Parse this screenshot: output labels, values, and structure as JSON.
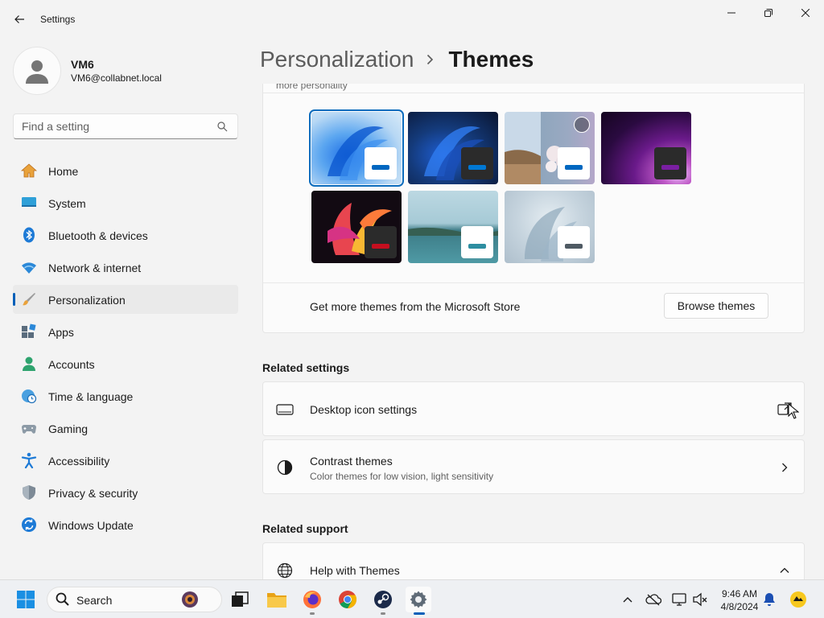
{
  "window": {
    "app_title": "Settings"
  },
  "profile": {
    "name": "VM6",
    "email": "VM6@collabnet.local"
  },
  "search": {
    "placeholder": "Find a setting"
  },
  "nav": {
    "items": [
      {
        "label": "Home",
        "icon": "home-icon",
        "selected": false
      },
      {
        "label": "System",
        "icon": "system-icon",
        "selected": false
      },
      {
        "label": "Bluetooth & devices",
        "icon": "bluetooth-icon",
        "selected": false
      },
      {
        "label": "Network & internet",
        "icon": "wifi-icon",
        "selected": false
      },
      {
        "label": "Personalization",
        "icon": "brush-icon",
        "selected": true
      },
      {
        "label": "Apps",
        "icon": "apps-icon",
        "selected": false
      },
      {
        "label": "Accounts",
        "icon": "accounts-icon",
        "selected": false
      },
      {
        "label": "Time & language",
        "icon": "clock-globe-icon",
        "selected": false
      },
      {
        "label": "Gaming",
        "icon": "gamepad-icon",
        "selected": false
      },
      {
        "label": "Accessibility",
        "icon": "accessibility-icon",
        "selected": false
      },
      {
        "label": "Privacy & security",
        "icon": "shield-icon",
        "selected": false
      },
      {
        "label": "Windows Update",
        "icon": "update-icon",
        "selected": false
      }
    ]
  },
  "header": {
    "parent": "Personalization",
    "current": "Themes"
  },
  "themes": {
    "cut_off_text": "more personality",
    "items": [
      {
        "name": "windows-light",
        "selected": true,
        "accent": "#0067c0",
        "badge": "#ffffff"
      },
      {
        "name": "windows-dark",
        "selected": false,
        "accent": "#0078d4",
        "badge": "#2b2b2b"
      },
      {
        "name": "windows-spotlight",
        "selected": false,
        "accent": "#0067c0",
        "badge": "#ffffff"
      },
      {
        "name": "glow",
        "selected": false,
        "accent": "#7a1fa2",
        "badge": "#2b2b2b"
      },
      {
        "name": "captured-motion",
        "selected": false,
        "accent": "#c50f1f",
        "badge": "#2b2b2b"
      },
      {
        "name": "sunrise",
        "selected": false,
        "accent": "#2d8ea1",
        "badge": "#ffffff"
      },
      {
        "name": "flow",
        "selected": false,
        "accent": "#4f5a63",
        "badge": "#ffffff"
      }
    ],
    "store_text": "Get more themes from the Microsoft Store",
    "browse_label": "Browse themes"
  },
  "related_settings": {
    "title": "Related settings",
    "desktop_icons": {
      "title": "Desktop icon settings",
      "icon": "monitor-icon",
      "end_icon": "open-external-icon"
    },
    "contrast": {
      "title": "Contrast themes",
      "subtitle": "Color themes for low vision, light sensitivity",
      "icon": "contrast-icon",
      "end_icon": "chevron-right-icon"
    }
  },
  "related_support": {
    "title": "Related support",
    "help": {
      "title": "Help with Themes",
      "icon": "globe-icon",
      "end_icon": "chevron-up-icon"
    }
  },
  "taskbar": {
    "search_label": "Search",
    "time": "9:46 AM",
    "date": "4/8/2024"
  },
  "colors": {
    "accent": "#005fb8",
    "selected_nav": "#eaeaea",
    "card": "#fbfbfb"
  }
}
